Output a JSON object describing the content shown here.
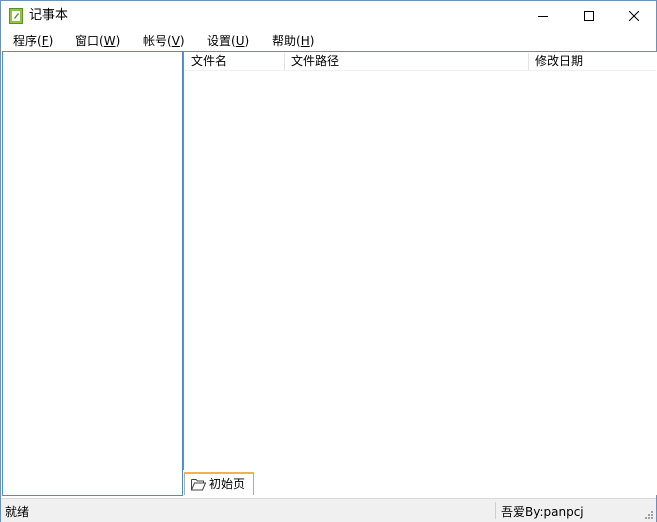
{
  "window": {
    "title": "记事本",
    "icon": "notepad-app-icon",
    "controls": [
      "minimize-icon",
      "maximize-icon",
      "close-icon"
    ]
  },
  "menu": {
    "items": [
      {
        "label": "程序(",
        "key": "F",
        "end": ")"
      },
      {
        "label": "窗口(",
        "key": "W",
        "end": ")"
      },
      {
        "label": "帐号(",
        "key": "V",
        "end": ")"
      },
      {
        "label": "设置(",
        "key": "U",
        "end": ")"
      },
      {
        "label": "帮助(",
        "key": "H",
        "end": ")"
      }
    ]
  },
  "file_list": {
    "columns": [
      "文件名",
      "文件路径",
      "修改日期"
    ],
    "rows": []
  },
  "tabs": [
    {
      "label": "初始页",
      "icon": "folder-open-icon",
      "selected": true
    }
  ],
  "status": {
    "left": "就绪",
    "right": "吾爱By:panpcj"
  },
  "colors": {
    "tab_accent": "#f3b24f",
    "left_panel_border": "#4a90c8",
    "app_icon": "#8dc63f"
  }
}
